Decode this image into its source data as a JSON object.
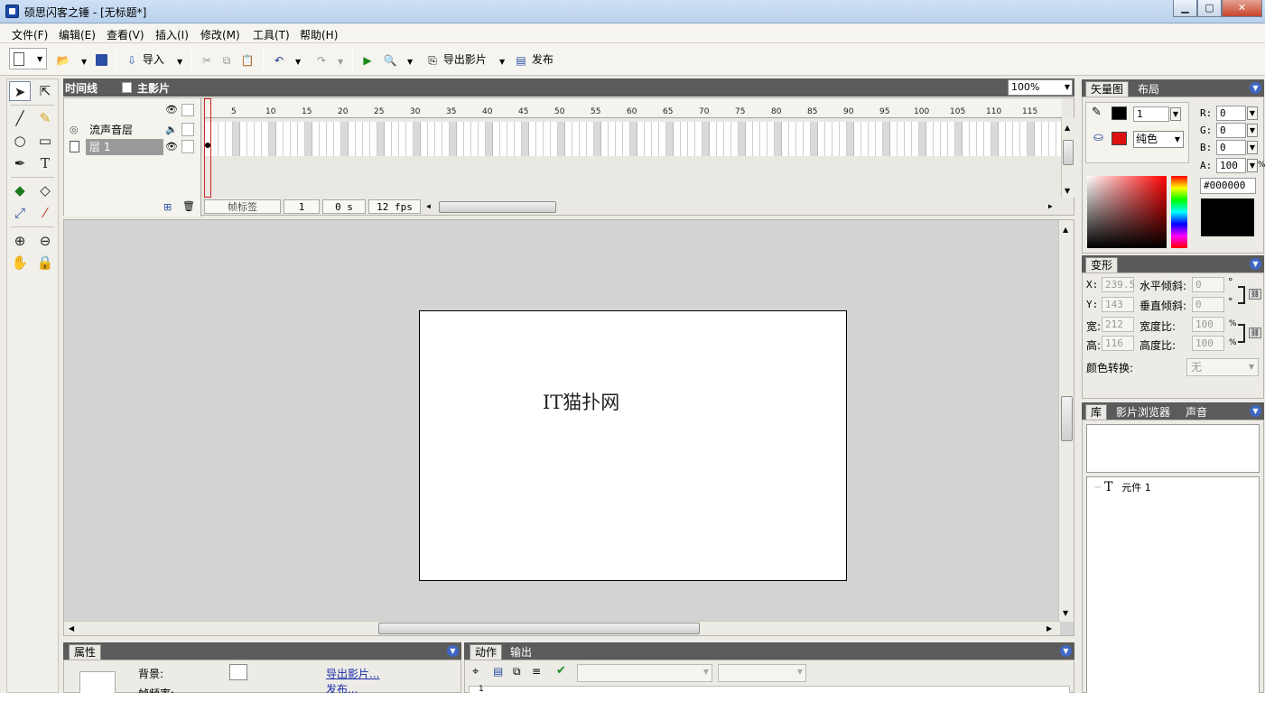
{
  "window": {
    "title": "硕思闪客之锤 - [无标题*]"
  },
  "menu": [
    "文件(F)",
    "编辑(E)",
    "查看(V)",
    "插入(I)",
    "修改(M)",
    "工具(T)",
    "帮助(H)"
  ],
  "toolbar": {
    "import_label": "导入",
    "export_movie_label": "导出影片",
    "publish_label": "发布"
  },
  "timeline": {
    "title": "时间线",
    "scene": "主影片",
    "zoom": "100%",
    "layers": [
      {
        "name": "流声音层"
      },
      {
        "name": "层 1"
      }
    ],
    "ruler": [
      "5",
      "10",
      "15",
      "20",
      "25",
      "30",
      "35",
      "40",
      "45",
      "50",
      "55",
      "60",
      "65",
      "70",
      "75",
      "80",
      "85",
      "90",
      "95",
      "100",
      "105",
      "110",
      "115"
    ],
    "status": {
      "frame_label": "帧标签",
      "frame": "1",
      "time": "0 s",
      "fps": "12 fps"
    }
  },
  "stage": {
    "text": "IT猫扑网"
  },
  "properties_panel": {
    "tab": "属性",
    "background_label": "背景:",
    "framerate_label": "帧频率:",
    "export_link": "导出影片...",
    "publish_link": "发布..."
  },
  "actions_panel": {
    "tabs": [
      "动作",
      "输出"
    ],
    "line_number": "1"
  },
  "vector_panel": {
    "tabs": [
      "矢量图",
      "布局"
    ],
    "stroke_width": "1",
    "fill_type": "纯色",
    "r_label": "R:",
    "g_label": "G:",
    "b_label": "B:",
    "a_label": "A:",
    "r": "0",
    "g": "0",
    "b": "0",
    "a": "100",
    "a_unit": "%",
    "hex": "#000000",
    "stroke_color": "#000000",
    "fill_color": "#dd1111"
  },
  "transform_panel": {
    "tab": "变形",
    "x_label": "X:",
    "x": "239.5",
    "y_label": "Y:",
    "y": "143",
    "w_label": "宽:",
    "w": "212",
    "h_label": "高:",
    "h": "116",
    "skew_h_label": "水平倾斜:",
    "skew_h": "0",
    "skew_v_label": "垂直倾斜:",
    "skew_v": "0",
    "scale_w_label": "宽度比:",
    "scale_w": "100",
    "scale_h_label": "高度比:",
    "scale_h": "100",
    "deg_unit": "°",
    "pct_unit": "%",
    "color_transform_label": "颜色转换:",
    "color_transform": "无"
  },
  "library_panel": {
    "tabs": [
      "库",
      "影片浏览器",
      "声音"
    ],
    "items": [
      "元件 1"
    ]
  }
}
